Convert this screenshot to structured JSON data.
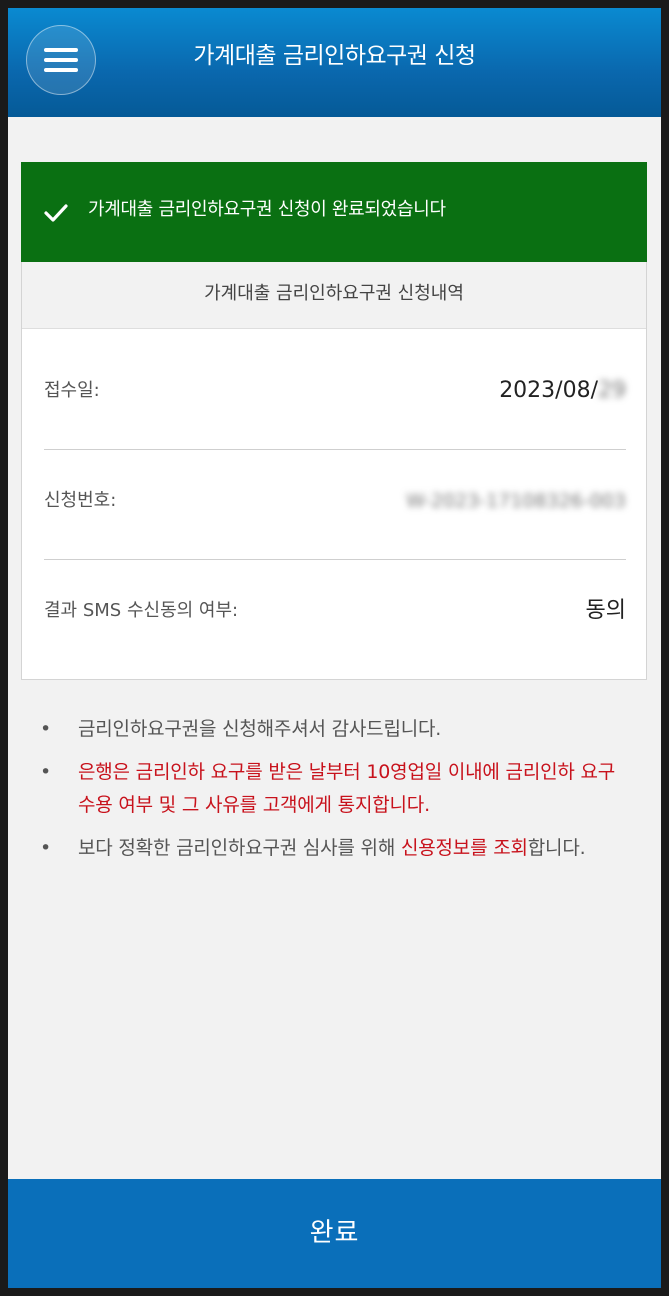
{
  "header": {
    "title": "가계대출 금리인하요구권 신청",
    "menu_icon": "hamburger-menu-icon"
  },
  "banner": {
    "icon": "checkmark-icon",
    "message": "가계대출 금리인하요구권 신청이 완료되었습니다",
    "color": "#0a7012"
  },
  "details": {
    "section_title": "가계대출 금리인하요구권 신청내역",
    "rows": [
      {
        "label": "접수일:",
        "value": "2023/08/",
        "value_hidden": "29"
      },
      {
        "label": "신청번호:",
        "value": "",
        "value_hidden": "W-2023-17108326-003"
      },
      {
        "label": "결과 SMS 수신동의 여부:",
        "value": "동의"
      }
    ]
  },
  "notes": [
    {
      "text": "금리인하요구권을 신청해주셔서 감사드립니다."
    },
    {
      "text": "은행은 금리인하 요구를 받은 날부터 10영업일 이내에 금리인하 요구 수용 여부 및 그 사유를 고객에게 통지합니다."
    },
    {
      "prefix": "보다 정확한 금리인하요구권 심사를 위해 ",
      "highlight": "신용정보를 조회",
      "suffix": "합니다."
    }
  ],
  "footer": {
    "button_label": "완료",
    "color": "#0a6fba"
  },
  "colors": {
    "header_blue": "#0a67ad",
    "alert_red": "#c8121c"
  }
}
